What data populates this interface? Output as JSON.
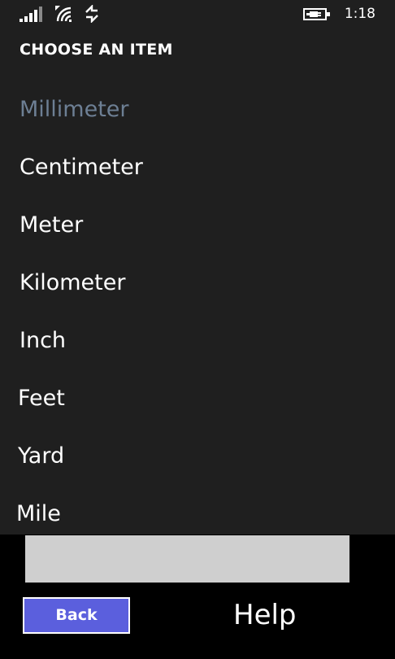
{
  "status_bar": {
    "time": "1:18",
    "icons": [
      "signal-strength-icon",
      "wifi-icon",
      "data-connection-icon",
      "battery-charging-icon"
    ]
  },
  "picker": {
    "title": "CHOOSE AN ITEM",
    "items": [
      {
        "label": "Millimeter",
        "selected": true
      },
      {
        "label": "Centimeter",
        "selected": false
      },
      {
        "label": "Meter",
        "selected": false
      },
      {
        "label": "Kilometer",
        "selected": false
      },
      {
        "label": "Inch",
        "selected": false
      },
      {
        "label": "Feet",
        "selected": false
      },
      {
        "label": "Yard",
        "selected": false
      },
      {
        "label": "Mile",
        "selected": false
      }
    ]
  },
  "footer": {
    "back_label": "Back",
    "help_label": "Help"
  },
  "colors": {
    "panel_background": "#1f1f1f",
    "selected_item": "#6d7f94",
    "back_button": "#5b5fdd",
    "ad_banner": "#cfcfcf"
  }
}
